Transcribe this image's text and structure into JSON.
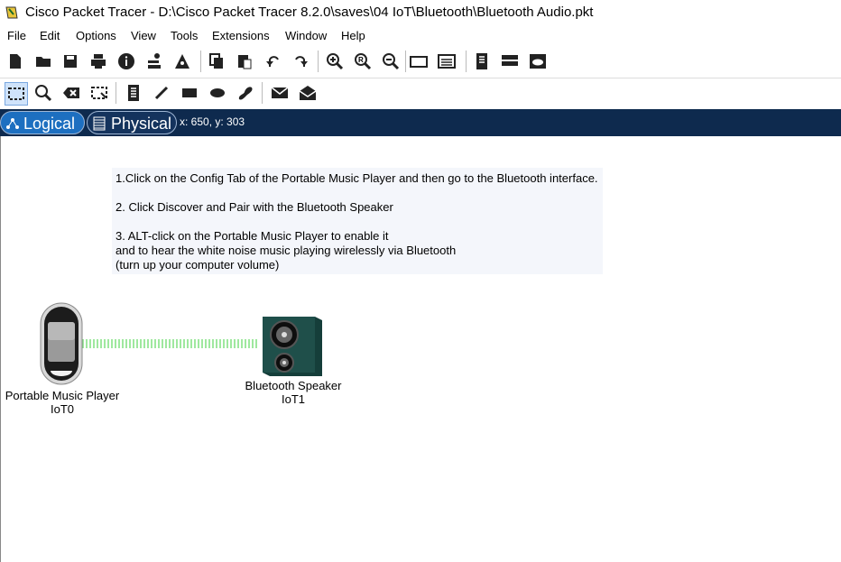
{
  "window": {
    "title": "Cisco Packet Tracer - D:\\Cisco Packet Tracer 8.2.0\\saves\\04 IoT\\Bluetooth\\Bluetooth Audio.pkt"
  },
  "menu": [
    "File",
    "Edit",
    "Options",
    "View",
    "Tools",
    "Extensions",
    "Window",
    "Help"
  ],
  "toolbar_main_icons": [
    "new-file-icon",
    "open-folder-icon",
    "save-icon",
    "print-icon",
    "info-icon",
    "network-wizard-icon",
    "activity-wizard-icon",
    "copy-icon",
    "paste-icon",
    "undo-icon",
    "redo-icon",
    "zoom-in-icon",
    "zoom-reset-icon",
    "zoom-out-icon",
    "drawing-palette-icon",
    "custom-device-dialog-icon",
    "viewport-icon",
    "cluster-icon",
    "cloud-icon"
  ],
  "toolbar_edit_icons": [
    "select-icon",
    "inspect-icon",
    "delete-icon",
    "resize-icon",
    "note-icon",
    "line-icon",
    "rectangle-icon",
    "ellipse-icon",
    "freeform-icon",
    "simple-pdu-icon",
    "complex-pdu-icon"
  ],
  "modes": {
    "logical": "Logical",
    "physical": "Physical"
  },
  "coordinates": "x: 650, y: 303",
  "note": {
    "line1": "1.Click on the Config Tab of the Portable Music Player and then go to the Bluetooth interface.",
    "line2": "2. Click Discover and Pair with the Bluetooth Speaker",
    "line3": "3. ALT-click on the Portable Music Player to enable it",
    "line4": "and to hear the white noise music playing wirelessly via Bluetooth",
    "line5": "(turn up your computer volume)"
  },
  "devices": {
    "player": {
      "name": "Portable Music Player",
      "id": "IoT0"
    },
    "speaker": {
      "name": "Bluetooth Speaker",
      "id": "IoT1"
    }
  },
  "colors": {
    "modebar": "#0e2a4e",
    "logical_active": "#1d6fc0",
    "wireless_link": "#7fe07f",
    "speaker_body": "#1f4f4a"
  }
}
